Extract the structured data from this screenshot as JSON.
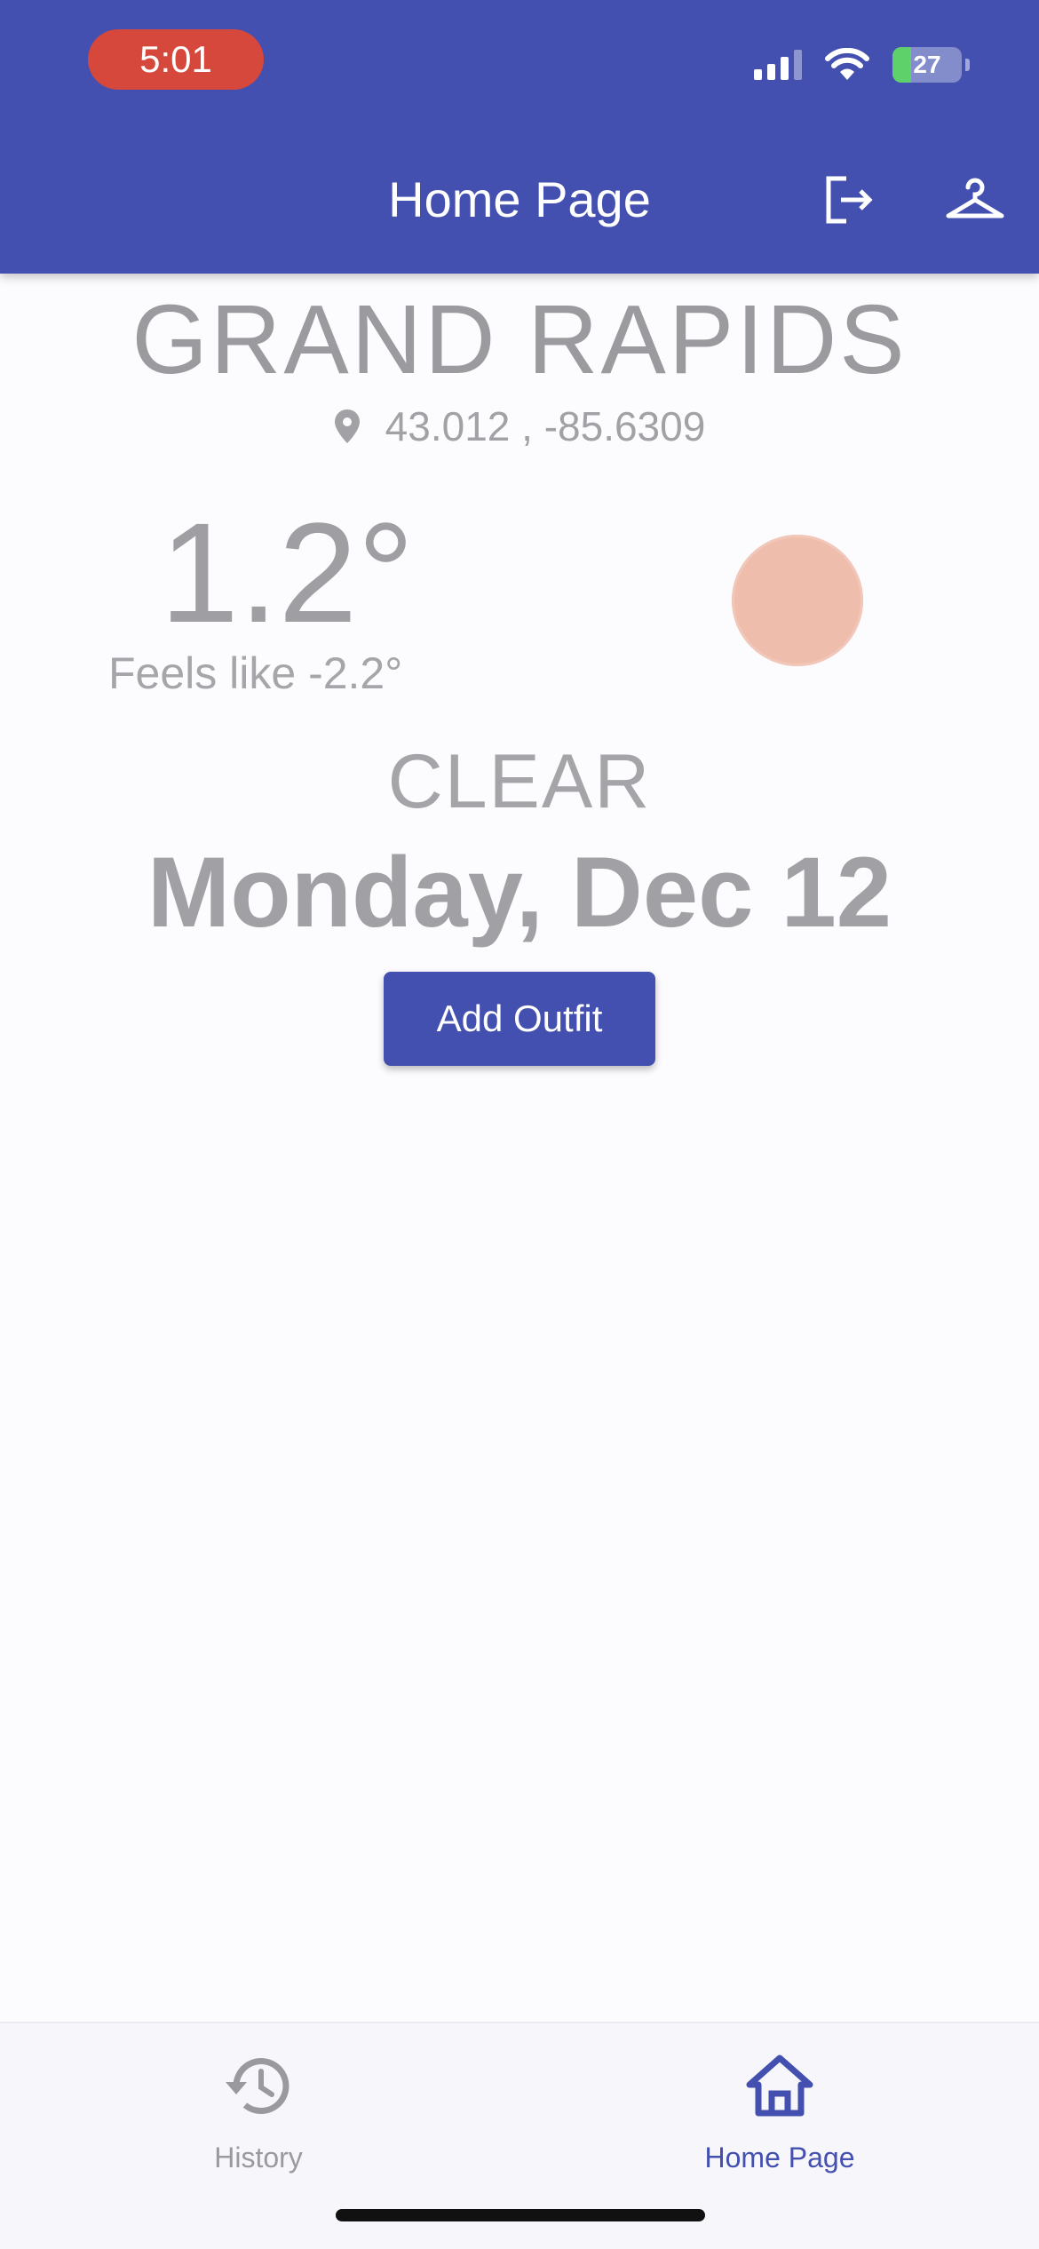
{
  "status_bar": {
    "time": "5:01",
    "battery_percent": "27",
    "battery_level": 0.27
  },
  "app_bar": {
    "title": "Home Page",
    "icons": [
      "logout-icon",
      "hanger-icon"
    ]
  },
  "weather": {
    "city": "GRAND RAPIDS",
    "coordinates": "43.012 , -85.6309",
    "temperature": "1.2°",
    "feels_like": "Feels like -2.2°",
    "condition": "CLEAR",
    "date": "Monday, Dec 12",
    "sun_color": "#efbdac"
  },
  "actions": {
    "add_outfit_label": "Add Outfit"
  },
  "bottom_nav": {
    "items": [
      {
        "label": "History",
        "icon": "history-icon",
        "active": false
      },
      {
        "label": "Home Page",
        "icon": "home-icon",
        "active": true
      }
    ]
  },
  "colors": {
    "primary": "#4350b0",
    "time_pill": "#d5483b",
    "background": "#fcfbfe",
    "muted_text": "#9f9fa3"
  }
}
